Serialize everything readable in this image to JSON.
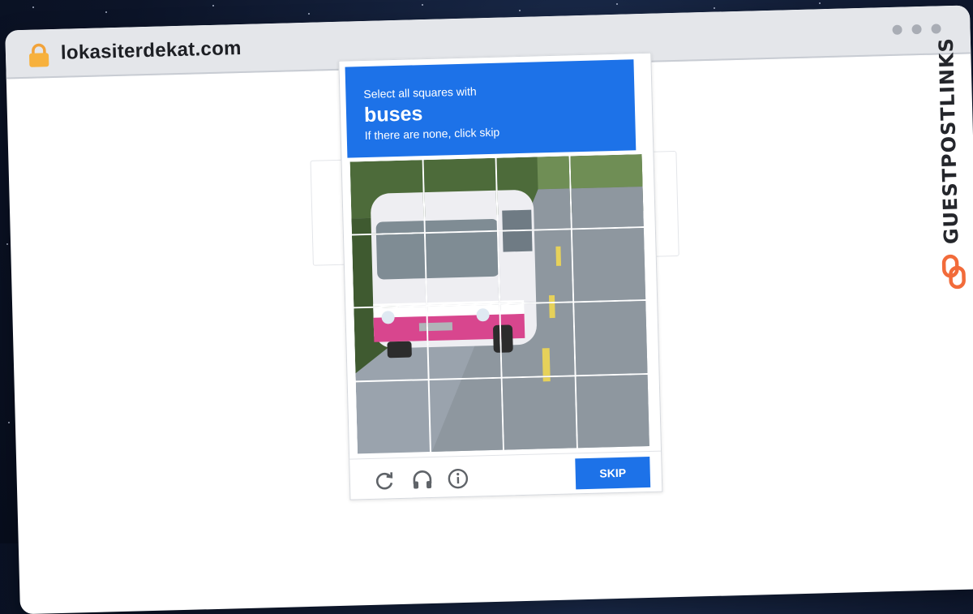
{
  "browser": {
    "url": "lokasiterdekat.com",
    "lock_icon": "lock-icon",
    "window_dots": 3
  },
  "captcha": {
    "instruction": "Select all squares with",
    "target": "buses",
    "hint": "If there are none, click skip",
    "grid_rows": 4,
    "grid_cols": 4,
    "controls": {
      "reload_icon": "reload-icon",
      "audio_icon": "headphones-icon",
      "info_icon": "info-icon",
      "skip_label": "SKIP"
    },
    "colors": {
      "accent": "#1d72e8"
    }
  },
  "brand": {
    "name": "GUESTPOSTLINKS",
    "icon": "chain-link-icon",
    "color": "#f26b3a"
  }
}
